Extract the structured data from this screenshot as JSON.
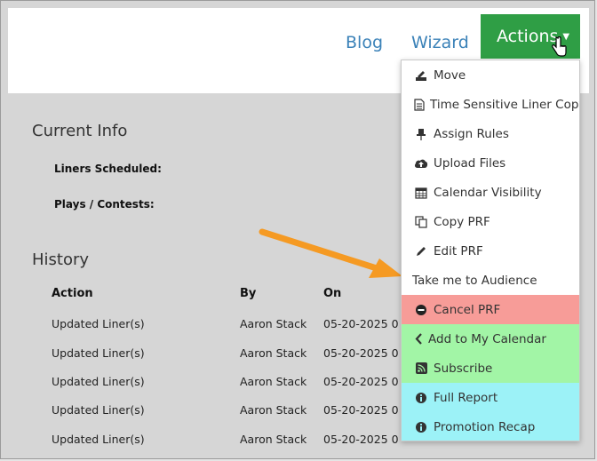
{
  "header": {
    "blog_label": "Blog",
    "wizard_label": "Wizard",
    "actions_label": "Actions"
  },
  "current_info": {
    "title": "Current Info",
    "liners_scheduled_label": "Liners Scheduled:",
    "plays_contests_label": "Plays / Contests:"
  },
  "history": {
    "title": "History",
    "columns": [
      "Action",
      "By",
      "On"
    ],
    "rows": [
      {
        "action": "Updated Liner(s)",
        "by": "Aaron Stack",
        "on": "05-20-2025 0"
      },
      {
        "action": "Updated Liner(s)",
        "by": "Aaron Stack",
        "on": "05-20-2025 0"
      },
      {
        "action": "Updated Liner(s)",
        "by": "Aaron Stack",
        "on": "05-20-2025 0"
      },
      {
        "action": "Updated Liner(s)",
        "by": "Aaron Stack",
        "on": "05-20-2025 0"
      },
      {
        "action": "Updated Liner(s)",
        "by": "Aaron Stack",
        "on": "05-20-2025 0"
      }
    ]
  },
  "menu": {
    "items": [
      {
        "label": "Move",
        "icon": "move-icon"
      },
      {
        "label": "Time Sensitive Liner Copy",
        "icon": "document-icon"
      },
      {
        "label": "Assign Rules",
        "icon": "pin-icon"
      },
      {
        "label": "Upload Files",
        "icon": "cloud-upload-icon"
      },
      {
        "label": "Calendar Visibility",
        "icon": "calendar-icon"
      },
      {
        "label": "Copy PRF",
        "icon": "copy-icon"
      },
      {
        "label": "Edit PRF",
        "icon": "pencil-icon"
      },
      {
        "label": "Take me to Audience",
        "icon": ""
      },
      {
        "label": "Cancel PRF",
        "icon": "minus-circle-icon"
      },
      {
        "label": "Add to My Calendar",
        "icon": "chevron-left-icon"
      },
      {
        "label": "Subscribe",
        "icon": "rss-icon"
      },
      {
        "label": "Full Report",
        "icon": "info-icon"
      },
      {
        "label": "Promotion Recap",
        "icon": "info-icon"
      }
    ]
  },
  "colors": {
    "actions_green": "#2f9e45",
    "cancel_red": "#f79c98",
    "calendar_green": "#a2f5a6",
    "report_cyan": "#9cf2f7",
    "arrow_orange": "#f59a23",
    "link_blue": "#3b82b8"
  }
}
